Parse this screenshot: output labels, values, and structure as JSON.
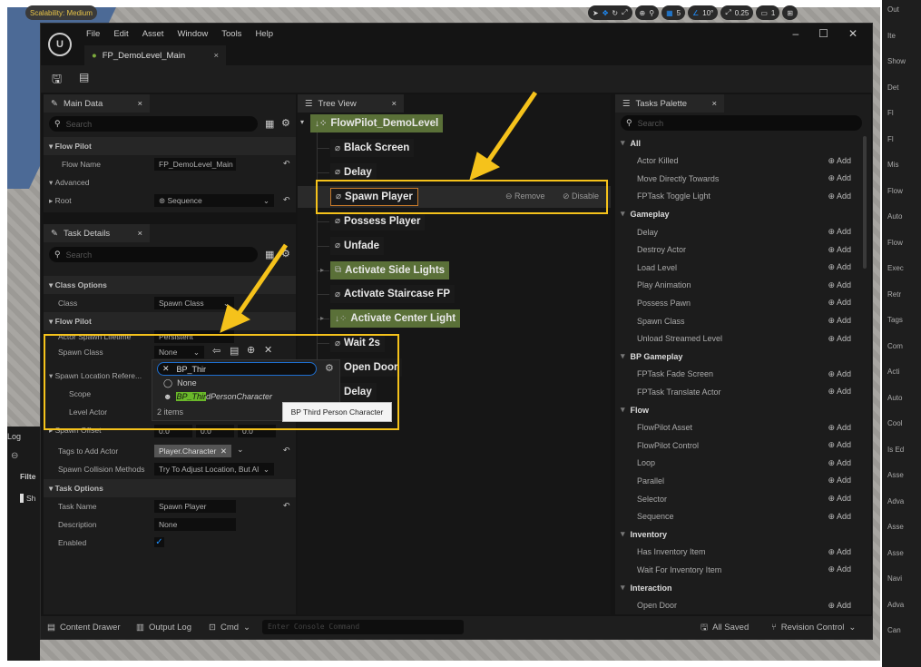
{
  "viewport": {
    "scalability": "Scalability: Medium",
    "grid_snap": "5",
    "angle_snap": "10°",
    "scale_snap": "0.25",
    "camera": "1"
  },
  "window": {
    "menu": [
      "File",
      "Edit",
      "Asset",
      "Window",
      "Tools",
      "Help"
    ],
    "tab": "FP_DemoLevel_Main"
  },
  "main_data": {
    "tab": "Main Data",
    "search_placeholder": "Search",
    "section": "Flow Pilot",
    "flow_name_label": "Flow Name",
    "flow_name_value": "FP_DemoLevel_Main",
    "advanced": "Advanced",
    "root_label": "Root",
    "root_value": "Sequence"
  },
  "task_details": {
    "tab": "Task Details",
    "search_placeholder": "Search",
    "class_options": "Class Options",
    "class_label": "Class",
    "class_value": "Spawn Class",
    "flow_pilot": "Flow Pilot",
    "lifetime_label": "Actor Spawn Lifetime",
    "lifetime_value": "Persistent",
    "spawn_class_label": "Spawn Class",
    "spawn_class_value": "None",
    "spawn_loc_label": "Spawn Location Refere...",
    "scope_label": "Scope",
    "level_actor_label": "Level Actor",
    "spawn_offset_label": "Spawn Offset",
    "offset": [
      "0.0",
      "0.0",
      "0.0"
    ],
    "tags_label": "Tags to Add Actor",
    "tag_value": "Player.Character",
    "collision_label": "Spawn Collision Methods",
    "collision_value": "Try To Adjust Location, But Al",
    "task_options": "Task Options",
    "task_name_label": "Task Name",
    "task_name_value": "Spawn Player",
    "description_label": "Description",
    "description_value": "None",
    "enabled_label": "Enabled",
    "enabled": true
  },
  "picker": {
    "search_value": "BP_Thir",
    "options": [
      {
        "label": "None"
      },
      {
        "label_match": "BP_Thir",
        "label_rest": "dPersonCharacter"
      }
    ],
    "count": "2 items",
    "tooltip": "BP Third Person Character"
  },
  "tree": {
    "tab": "Tree View",
    "root": "FlowPilot_DemoLevel",
    "nodes": [
      {
        "label": "Black Screen",
        "type": "leaf"
      },
      {
        "label": "Delay",
        "type": "leaf"
      },
      {
        "label": "Spawn Player",
        "type": "leaf",
        "selected": true
      },
      {
        "label": "Possess Player",
        "type": "leaf"
      },
      {
        "label": "Unfade",
        "type": "leaf"
      },
      {
        "label": "Activate Side Lights",
        "type": "parallel"
      },
      {
        "label": "Activate Staircase FP",
        "type": "leaf"
      },
      {
        "label": "Activate Center Light",
        "type": "sequence"
      },
      {
        "label": "Wait 2s",
        "type": "leaf"
      },
      {
        "label": "Open Door",
        "type": "leaf"
      },
      {
        "label": "Delay",
        "type": "leaf"
      }
    ],
    "remove_label": "Remove",
    "disable_label": "Disable"
  },
  "palette": {
    "tab": "Tasks Palette",
    "search_placeholder": "Search",
    "add_label": "Add",
    "groups": [
      {
        "name": "All",
        "items": [
          "Actor Killed",
          "Move Directly Towards",
          "FPTask Toggle Light"
        ]
      },
      {
        "name": "Gameplay",
        "items": [
          "Delay",
          "Destroy Actor",
          "Load Level",
          "Play Animation",
          "Possess Pawn",
          "Spawn Class",
          "Unload Streamed Level"
        ]
      },
      {
        "name": "BP Gameplay",
        "items": [
          "FPTask Fade Screen",
          "FPTask Translate Actor"
        ]
      },
      {
        "name": "Flow",
        "items": [
          "FlowPilot Asset",
          "FlowPilot Control",
          "Loop",
          "Parallel",
          "Selector",
          "Sequence"
        ]
      },
      {
        "name": "Inventory",
        "items": [
          "Has Inventory Item",
          "Wait For Inventory Item"
        ]
      },
      {
        "name": "Interaction",
        "items": [
          "Open Door"
        ]
      }
    ]
  },
  "bottom": {
    "content_drawer": "Content Drawer",
    "output_log": "Output Log",
    "cmd": "Cmd",
    "console_placeholder": "Enter Console Command",
    "saved": "All Saved",
    "revision": "Revision Control"
  },
  "background": {
    "log": "Log",
    "filter": "Filte",
    "sh": "Sh",
    "right": [
      "Out",
      "Ite",
      "Show",
      "Det",
      "Fl",
      "Fl",
      "Mis",
      "Flow",
      "Auto",
      "Flow",
      "Exec",
      "Retr",
      "Tags",
      "Com",
      "Acti",
      "Auto",
      "Cool",
      "Is Ed",
      "Asse",
      "Adva",
      "Asse",
      "Asse",
      "Navi",
      "Adva",
      "Can"
    ]
  },
  "colors": {
    "highlight": "#f5c21b",
    "node_green": "#5a7038",
    "accent_blue": "#1e8fff"
  }
}
